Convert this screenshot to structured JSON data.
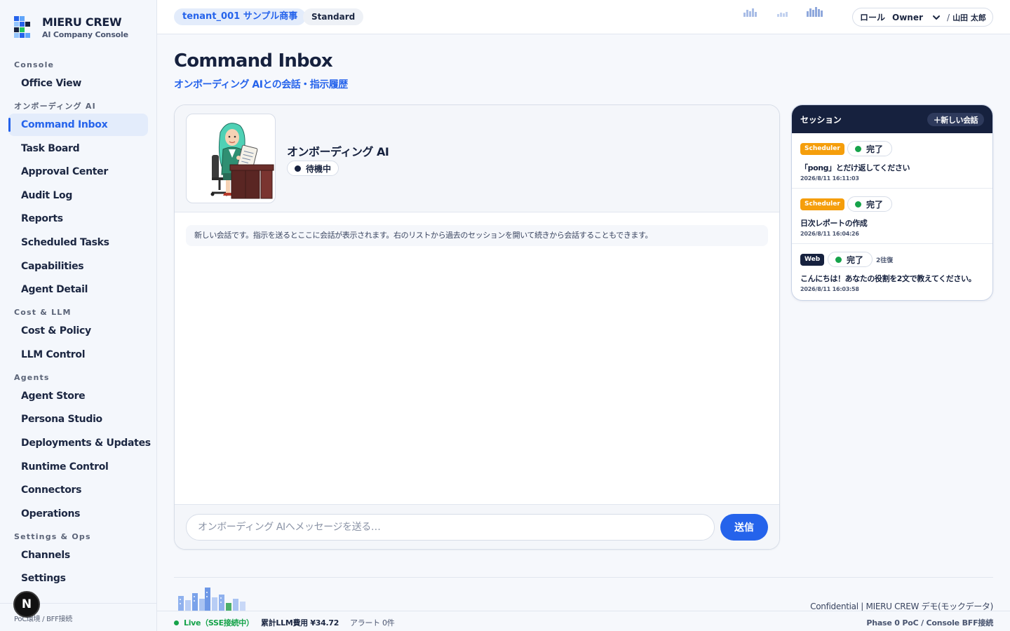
{
  "brand": {
    "title": "MIERU CREW",
    "subtitle": "AI Company Console"
  },
  "sidebar": {
    "sections": [
      {
        "label": "Console",
        "items": [
          {
            "label": "Office View"
          }
        ]
      },
      {
        "label": "オンボーディング AI",
        "items": [
          {
            "label": "Command Inbox",
            "active": true
          },
          {
            "label": "Task Board"
          },
          {
            "label": "Approval Center"
          },
          {
            "label": "Audit Log"
          },
          {
            "label": "Reports"
          },
          {
            "label": "Scheduled Tasks"
          },
          {
            "label": "Capabilities"
          },
          {
            "label": "Agent Detail"
          }
        ]
      },
      {
        "label": "Cost & LLM",
        "items": [
          {
            "label": "Cost & Policy"
          },
          {
            "label": "LLM Control"
          }
        ]
      },
      {
        "label": "Agents",
        "items": [
          {
            "label": "Agent Store"
          },
          {
            "label": "Persona Studio"
          },
          {
            "label": "Deployments & Updates"
          },
          {
            "label": "Runtime Control"
          },
          {
            "label": "Connectors"
          },
          {
            "label": "Operations"
          }
        ]
      },
      {
        "label": "Settings & Ops",
        "items": [
          {
            "label": "Channels"
          },
          {
            "label": "Settings"
          }
        ]
      }
    ],
    "footer": "PoC環境 / BFF接続",
    "badge": "N"
  },
  "topbar": {
    "tenant": "tenant_001 サンプル商事",
    "plan": "Standard",
    "role_label": "ロール",
    "role_value": "Owner",
    "separator": "/",
    "user": "山田 太郎"
  },
  "page": {
    "title": "Command Inbox",
    "subtitle": "オンボーディング AIとの会話・指示履歴"
  },
  "chat": {
    "agent_name": "オンボーディング AI",
    "status": "待機中",
    "hint": "新しい会話です。指示を送るとここに会話が表示されます。右のリストから過去のセッションを開いて続きから会話することもできます。",
    "input_placeholder": "オンボーディング AIへメッセージを送る…",
    "send_label": "送信"
  },
  "sessions": {
    "title": "セッション",
    "new_label": "＋新しい会話",
    "items": [
      {
        "source": "Scheduler",
        "status": "完了",
        "message": "「pong」とだけ返してください",
        "time": "2026/8/11 16:11:03"
      },
      {
        "source": "Scheduler",
        "status": "完了",
        "message": "日次レポートの作成",
        "time": "2026/8/11 16:04:26"
      },
      {
        "source": "Web",
        "status": "完了",
        "turns": "2往復",
        "message": "こんにちは！あなたの役割を2文で教えてください。",
        "time": "2026/8/11 16:03:58"
      }
    ]
  },
  "footer": {
    "confidential": "Confidential | MIERU CREW デモ(モックデータ)",
    "live": "Live（SSE接続中）",
    "cost": "累計LLM費用 ¥34.72",
    "alert": "アラート 0件",
    "phase": "Phase 0 PoC / Console BFF接続"
  },
  "colors": {
    "accent": "#2563eb",
    "navy": "#16213e",
    "scheduler": "#f59e0b",
    "success": "#16a34a"
  },
  "icons": {
    "select": "chevron-down-icon",
    "status": "status-dot-icon"
  }
}
